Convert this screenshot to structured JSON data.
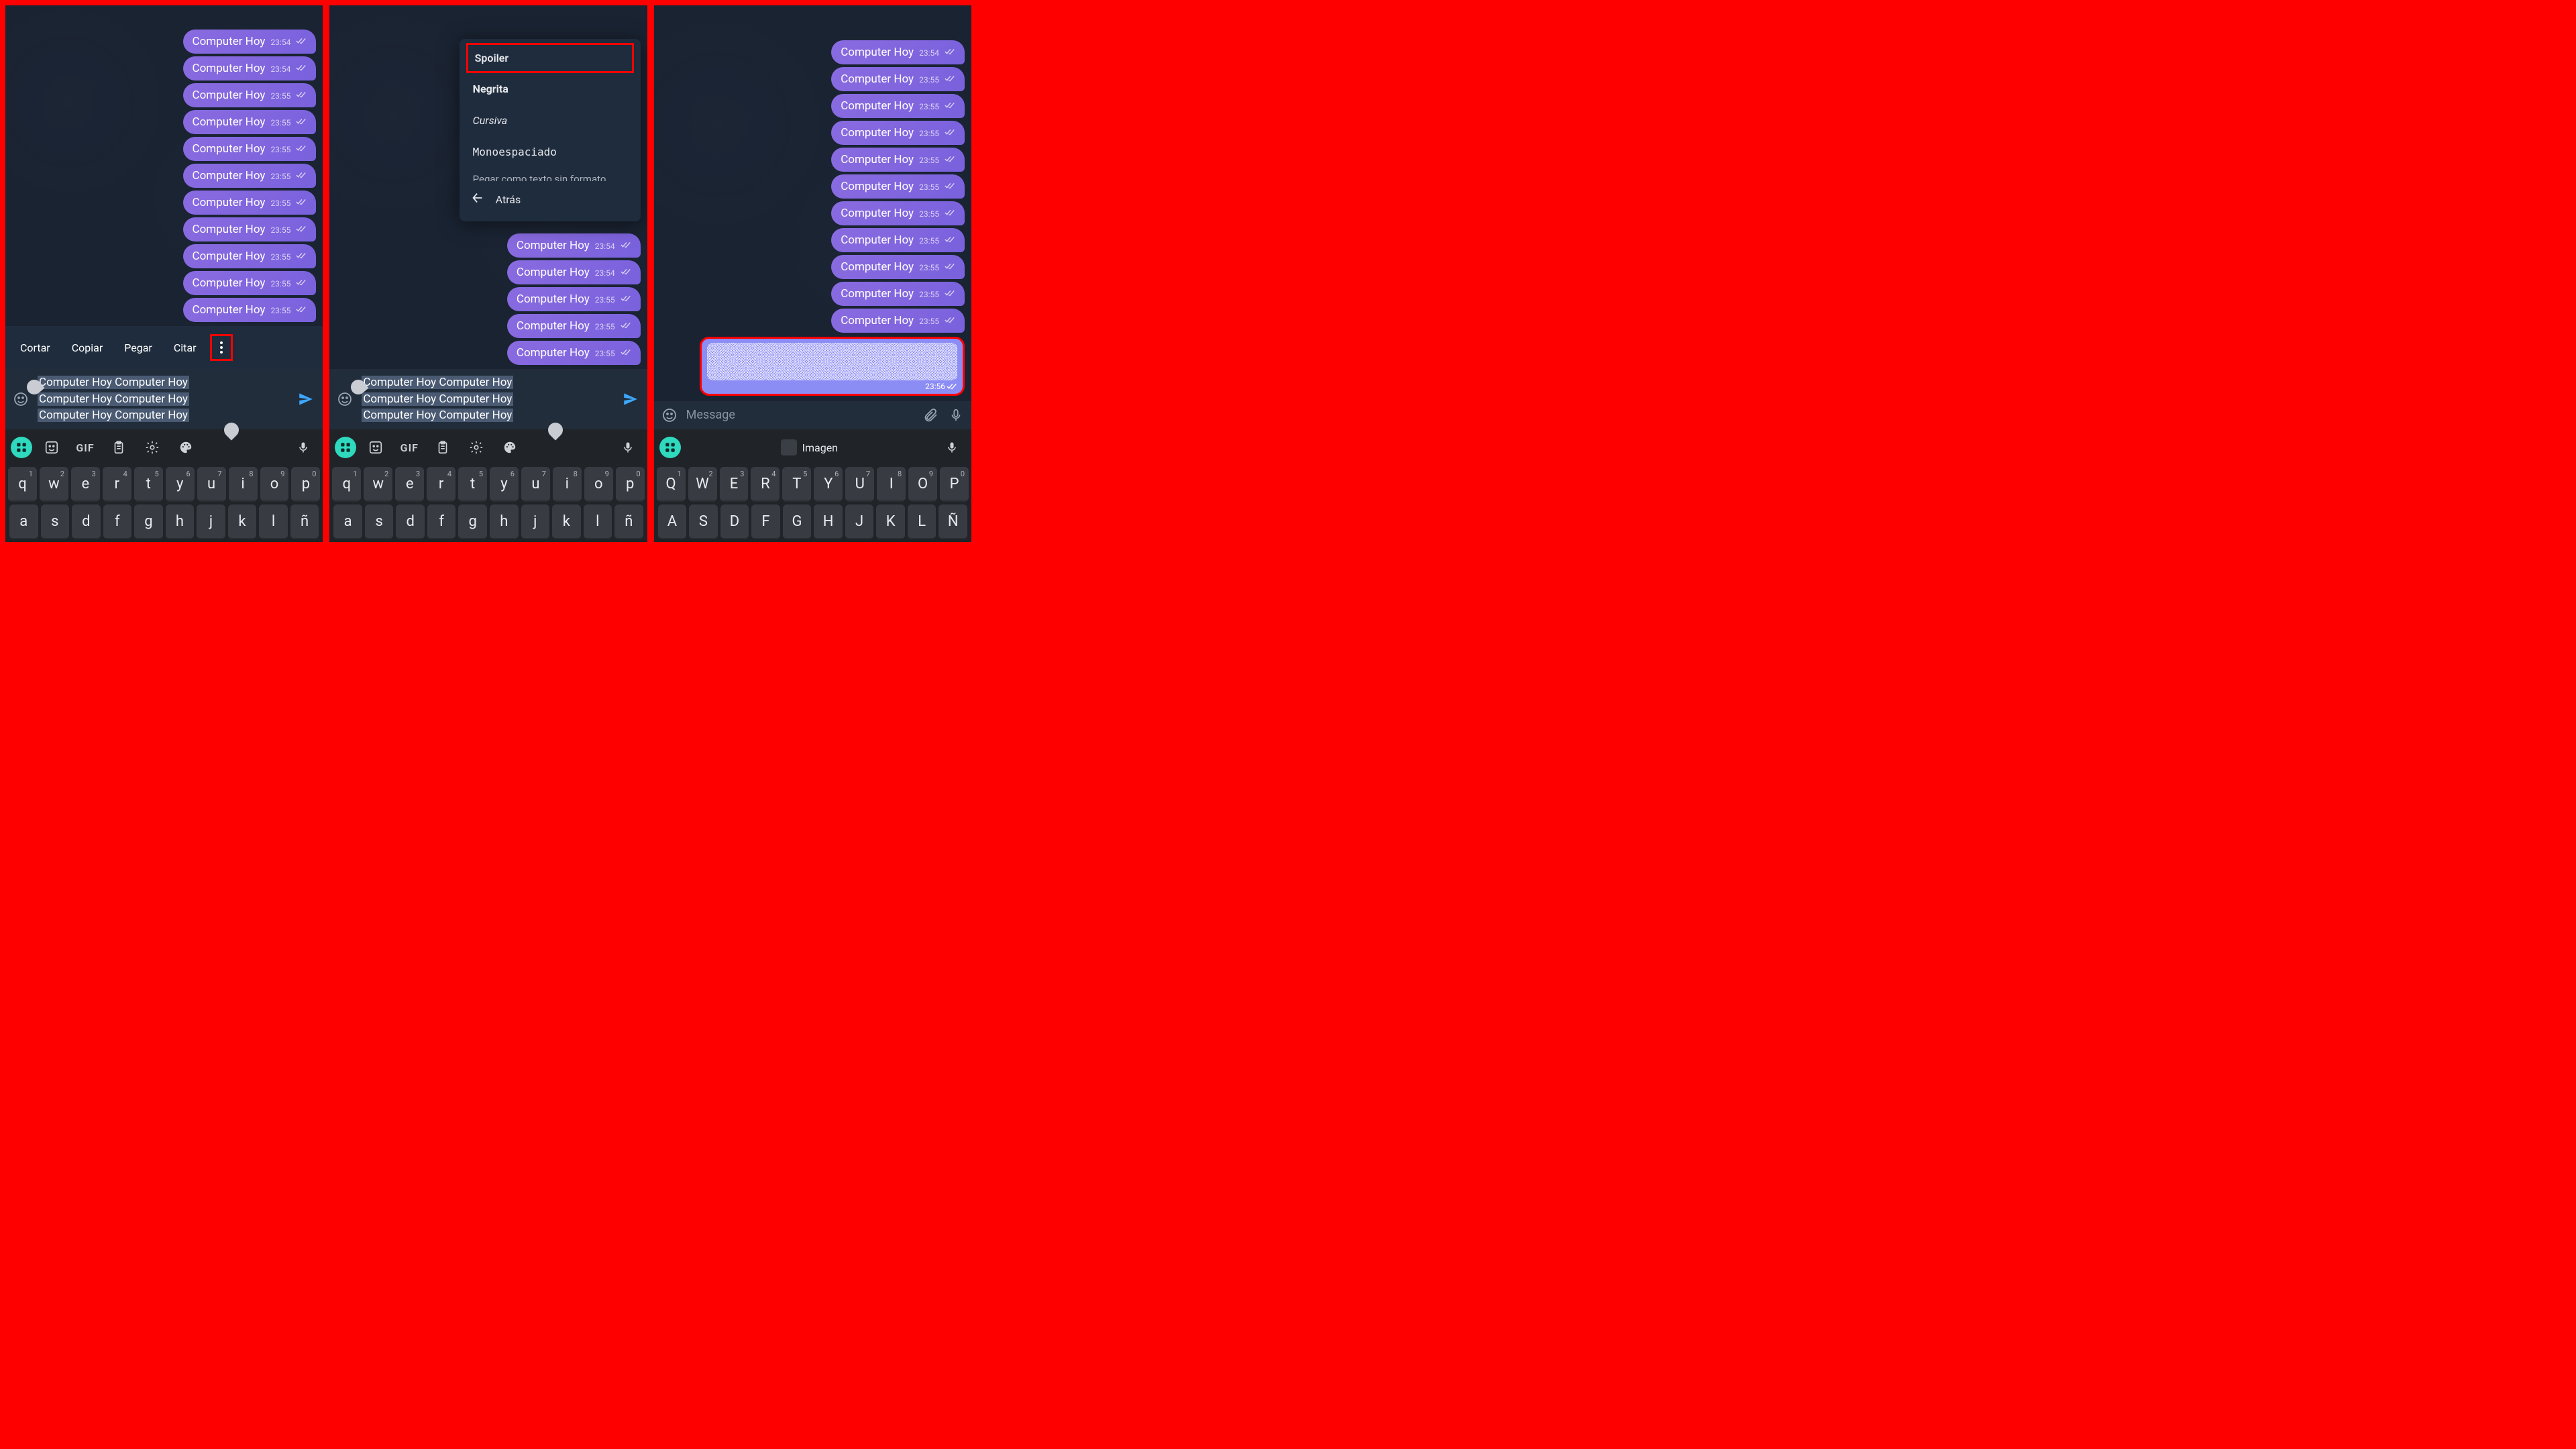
{
  "app": "Telegram",
  "message_text": "Computer Hoy",
  "screen1": {
    "messages": [
      {
        "text": "Computer Hoy",
        "time": "23:54",
        "read": true
      },
      {
        "text": "Computer Hoy",
        "time": "23:54",
        "read": true
      },
      {
        "text": "Computer Hoy",
        "time": "23:55",
        "read": true
      },
      {
        "text": "Computer Hoy",
        "time": "23:55",
        "read": true
      },
      {
        "text": "Computer Hoy",
        "time": "23:55",
        "read": true
      },
      {
        "text": "Computer Hoy",
        "time": "23:55",
        "read": true
      },
      {
        "text": "Computer Hoy",
        "time": "23:55",
        "read": true
      },
      {
        "text": "Computer Hoy",
        "time": "23:55",
        "read": true
      },
      {
        "text": "Computer Hoy",
        "time": "23:55",
        "read": true
      },
      {
        "text": "Computer Hoy",
        "time": "23:55",
        "read": true
      },
      {
        "text": "Computer Hoy",
        "time": "23:55",
        "read": true
      }
    ],
    "context_menu": {
      "cut": "Cortar",
      "copy": "Copiar",
      "paste": "Pegar",
      "quote": "Citar"
    },
    "input_value": "Computer Hoy Computer Hoy\nComputer Hoy Computer Hoy\nComputer Hoy Computer Hoy",
    "input_line1": "Computer Hoy Computer Hoy",
    "input_line2": "Computer Hoy Computer Hoy",
    "input_line3": "Computer Hoy Computer Hoy"
  },
  "screen2": {
    "messages": [
      {
        "text": "Computer Hoy",
        "time": "23:54",
        "read": true
      },
      {
        "text": "Computer Hoy",
        "time": "23:54",
        "read": true
      },
      {
        "text": "Computer Hoy",
        "time": "23:55",
        "read": true
      },
      {
        "text": "Computer Hoy",
        "time": "23:55",
        "read": true
      },
      {
        "text": "Computer Hoy",
        "time": "23:55",
        "read": true
      }
    ],
    "format_menu": {
      "spoiler": "Spoiler",
      "bold": "Negrita",
      "italic": "Cursiva",
      "mono": "Monoespaciado",
      "cutoff": "Pegar como texto sin formato",
      "back": "Atrás"
    },
    "input_line1": "Computer Hoy Computer Hoy",
    "input_line2": "Computer Hoy Computer Hoy",
    "input_line3": "Computer Hoy Computer Hoy"
  },
  "screen3": {
    "messages": [
      {
        "text": "Computer Hoy",
        "time": "23:54",
        "read": true
      },
      {
        "text": "Computer Hoy",
        "time": "23:55",
        "read": true
      },
      {
        "text": "Computer Hoy",
        "time": "23:55",
        "read": true
      },
      {
        "text": "Computer Hoy",
        "time": "23:55",
        "read": true
      },
      {
        "text": "Computer Hoy",
        "time": "23:55",
        "read": true
      },
      {
        "text": "Computer Hoy",
        "time": "23:55",
        "read": true
      },
      {
        "text": "Computer Hoy",
        "time": "23:55",
        "read": true
      },
      {
        "text": "Computer Hoy",
        "time": "23:55",
        "read": true
      },
      {
        "text": "Computer Hoy",
        "time": "23:55",
        "read": true
      },
      {
        "text": "Computer Hoy",
        "time": "23:55",
        "read": true
      },
      {
        "text": "Computer Hoy",
        "time": "23:55",
        "read": true
      }
    ],
    "spoiler_time": "23:56",
    "input_placeholder": "Message",
    "suggestion": "Imagen"
  },
  "keyboard": {
    "gif_label": "GIF",
    "row1": [
      "q",
      "w",
      "e",
      "r",
      "t",
      "y",
      "u",
      "i",
      "o",
      "p"
    ],
    "row1_sup": [
      "1",
      "2",
      "3",
      "4",
      "5",
      "6",
      "7",
      "8",
      "9",
      "0"
    ],
    "row2": [
      "a",
      "s",
      "d",
      "f",
      "g",
      "h",
      "j",
      "k",
      "l",
      "ñ"
    ],
    "row1_upper": [
      "Q",
      "W",
      "E",
      "R",
      "T",
      "Y",
      "U",
      "I",
      "O",
      "P"
    ],
    "row2_upper": [
      "A",
      "S",
      "D",
      "F",
      "G",
      "H",
      "J",
      "K",
      "L",
      "Ñ"
    ]
  }
}
